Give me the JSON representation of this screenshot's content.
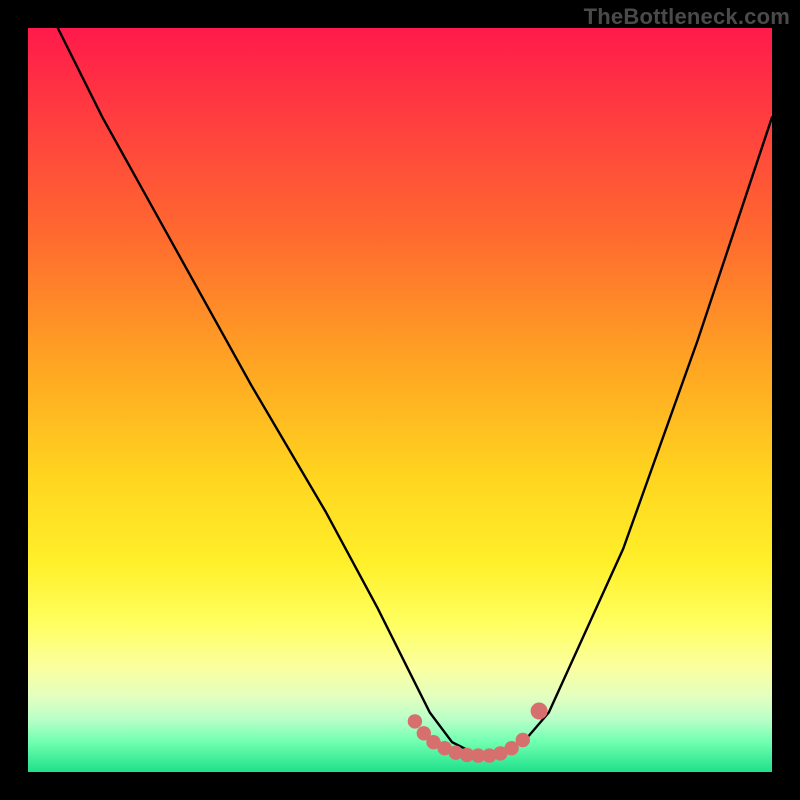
{
  "watermark": "TheBottleneck.com",
  "chart_data": {
    "type": "line",
    "title": "",
    "xlabel": "",
    "ylabel": "",
    "xlim": [
      0,
      100
    ],
    "ylim": [
      0,
      100
    ],
    "series": [
      {
        "name": "bottleneck-curve",
        "x_pct": [
          4,
          10,
          20,
          30,
          40,
          47,
          51,
          54,
          57,
          60,
          62,
          64,
          67,
          70,
          80,
          90,
          100
        ],
        "y_pct": [
          100,
          88,
          70,
          52,
          35,
          22,
          14,
          8,
          4,
          2.5,
          2.2,
          2.7,
          4.5,
          8,
          30,
          58,
          88
        ]
      }
    ],
    "markers": {
      "name": "optimal-range",
      "color": "#d86f6f",
      "points_pct": [
        {
          "x": 52.0,
          "y": 6.8
        },
        {
          "x": 53.2,
          "y": 5.2
        },
        {
          "x": 54.5,
          "y": 4.0
        },
        {
          "x": 56.0,
          "y": 3.2
        },
        {
          "x": 57.5,
          "y": 2.6
        },
        {
          "x": 59.0,
          "y": 2.3
        },
        {
          "x": 60.5,
          "y": 2.2
        },
        {
          "x": 62.0,
          "y": 2.2
        },
        {
          "x": 63.5,
          "y": 2.5
        },
        {
          "x": 65.0,
          "y": 3.2
        },
        {
          "x": 66.5,
          "y": 4.3
        },
        {
          "x": 68.7,
          "y": 8.2
        }
      ]
    },
    "gradient_stops": [
      {
        "pos": 0,
        "color": "#ff1a4b"
      },
      {
        "pos": 12,
        "color": "#ff3d3f"
      },
      {
        "pos": 28,
        "color": "#ff6a2f"
      },
      {
        "pos": 45,
        "color": "#ffa423"
      },
      {
        "pos": 60,
        "color": "#ffd41f"
      },
      {
        "pos": 72,
        "color": "#fff02a"
      },
      {
        "pos": 80,
        "color": "#ffff60"
      },
      {
        "pos": 86,
        "color": "#fbffa0"
      },
      {
        "pos": 90,
        "color": "#e2ffc0"
      },
      {
        "pos": 93,
        "color": "#b7ffc8"
      },
      {
        "pos": 96,
        "color": "#6fffb0"
      },
      {
        "pos": 100,
        "color": "#1fe08a"
      }
    ]
  }
}
